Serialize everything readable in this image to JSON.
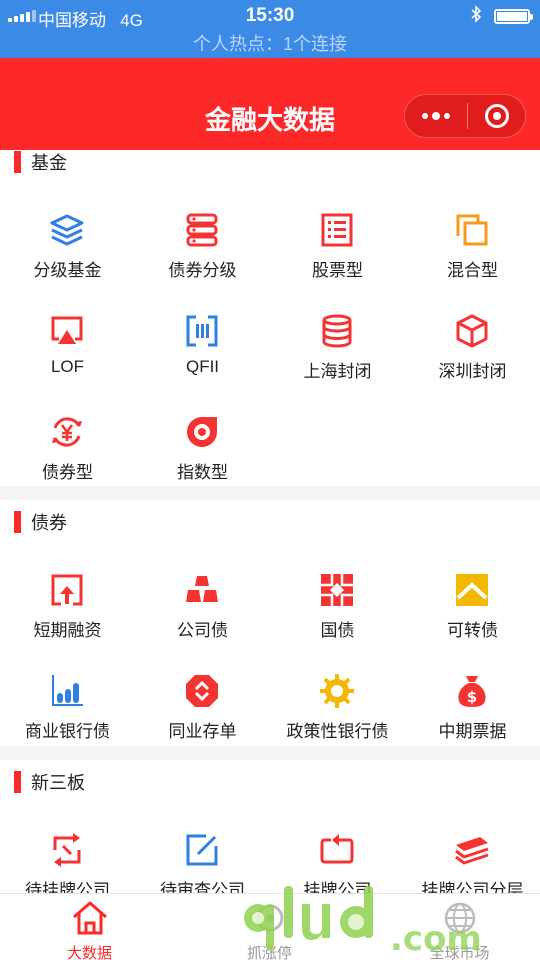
{
  "status_bar": {
    "carrier": "中国移动",
    "network": "4G",
    "time": "15:30",
    "hotspot": "个人热点：1个连接"
  },
  "nav": {
    "title": "金融大数据"
  },
  "sections": [
    {
      "title": "基金",
      "items": [
        {
          "label": "分级基金",
          "icon": "layers-icon",
          "color": "#2f7fe6"
        },
        {
          "label": "债券分级",
          "icon": "server-icon",
          "color": "#f53333"
        },
        {
          "label": "股票型",
          "icon": "list-icon",
          "color": "#f53333"
        },
        {
          "label": "混合型",
          "icon": "windows-icon",
          "color": "#f59a1e"
        },
        {
          "label": "LOF",
          "icon": "screen-upload-icon",
          "color": "#f53333"
        },
        {
          "label": "QFII",
          "icon": "barcode-icon",
          "color": "#2f7fe6"
        },
        {
          "label": "上海封闭",
          "icon": "database-icon",
          "color": "#f53333"
        },
        {
          "label": "深圳封闭",
          "icon": "cube-icon",
          "color": "#f53333"
        },
        {
          "label": "债券型",
          "icon": "yen-cycle-icon",
          "color": "#f53333"
        },
        {
          "label": "指数型",
          "icon": "disc-icon",
          "color": "#f53333"
        }
      ]
    },
    {
      "title": "债券",
      "items": [
        {
          "label": "短期融资",
          "icon": "upload-box-icon",
          "color": "#f53333"
        },
        {
          "label": "公司债",
          "icon": "gold-bars-icon",
          "color": "#f53333"
        },
        {
          "label": "国债",
          "icon": "red-cross-icon",
          "color": "#f53333"
        },
        {
          "label": "可转债",
          "icon": "chevron-up-icon",
          "color": "#f5b800"
        },
        {
          "label": "商业银行债",
          "icon": "bar-chart-icon",
          "color": "#2f7fe6"
        },
        {
          "label": "同业存单",
          "icon": "octagon-icon",
          "color": "#f53333"
        },
        {
          "label": "政策性银行债",
          "icon": "sun-gear-icon",
          "color": "#f5b800"
        },
        {
          "label": "中期票据",
          "icon": "money-bag-icon",
          "color": "#f53333"
        }
      ]
    },
    {
      "title": "新三板",
      "items": [
        {
          "label": "待挂牌公司",
          "icon": "swap-arrows-icon",
          "color": "#f53333"
        },
        {
          "label": "待审查公司",
          "icon": "edit-icon",
          "color": "#2f7fe6"
        },
        {
          "label": "挂牌公司",
          "icon": "refresh-box-icon",
          "color": "#f53333"
        },
        {
          "label": "挂牌公司分层",
          "icon": "stack-icon",
          "color": "#f53333"
        }
      ]
    }
  ],
  "tabs": [
    {
      "label": "大数据",
      "icon": "home-icon",
      "active": true
    },
    {
      "label": "抓涨停",
      "icon": "target-icon",
      "active": false
    },
    {
      "label": "",
      "icon": "blank",
      "active": false
    },
    {
      "label": "全球市场",
      "icon": "globe-icon",
      "active": false
    }
  ],
  "colors": {
    "status_bar": "#3b8ae6",
    "nav_bar": "#fd2929",
    "accent_red": "#f53333",
    "accent_blue": "#2f7fe6",
    "accent_yellow": "#f5b800"
  }
}
